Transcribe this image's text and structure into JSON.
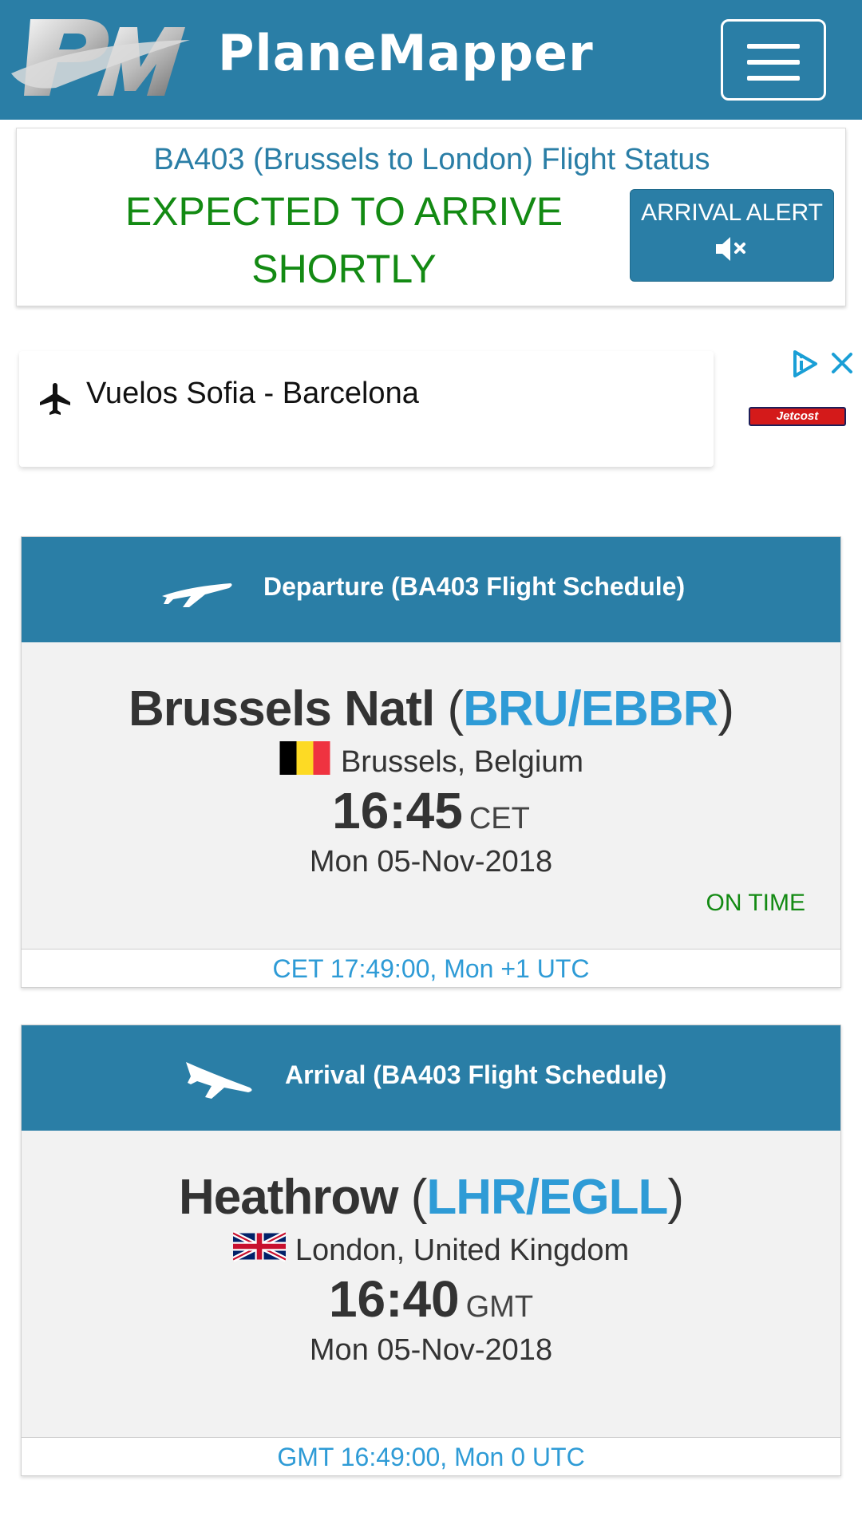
{
  "header": {
    "brand": "PlaneMapper",
    "brand_color": "#2a7ea6",
    "menu_icon": "hamburger-menu-icon"
  },
  "status": {
    "title": "BA403 (Brussels to London) Flight Status",
    "text": "EXPECTED TO ARRIVE SHORTLY",
    "text_color": "#138a13",
    "alert_label": "ARRIVAL ALERT",
    "alert_icon": "speaker-muted-icon"
  },
  "ad": {
    "text": "Vuelos Sofia - Barcelona",
    "brand": "Jetcost",
    "icons": [
      "plane-icon",
      "adchoices-icon",
      "close-icon"
    ]
  },
  "departure": {
    "header": "Departure (BA403 Flight Schedule)",
    "airport_name": "Brussels Natl",
    "airport_code": "BRU/EBBR",
    "city": "Brussels, Belgium",
    "flag": "belgium-flag",
    "time": "16:45",
    "timezone": "CET",
    "date": "Mon 05-Nov-2018",
    "status": "ON TIME",
    "footer": "CET 17:49:00, Mon +1 UTC"
  },
  "arrival": {
    "header": "Arrival (BA403 Flight Schedule)",
    "airport_name": "Heathrow",
    "airport_code": "LHR/EGLL",
    "city": "London, United Kingdom",
    "flag": "uk-flag",
    "time": "16:40",
    "timezone": "GMT",
    "date": "Mon 05-Nov-2018",
    "footer": "GMT 16:49:00, Mon 0 UTC"
  }
}
